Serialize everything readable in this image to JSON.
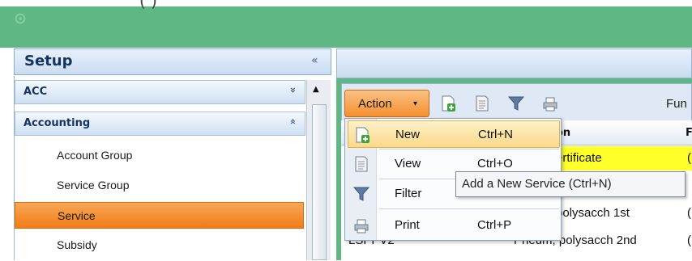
{
  "top_partial_text": "(          )",
  "sidebar": {
    "title": "Setup",
    "collapse_glyph": "«",
    "groups": [
      {
        "label": "ACC",
        "chevron": "»"
      },
      {
        "label": "Accounting",
        "chevron": "«"
      }
    ],
    "items": [
      {
        "label": "Account Group"
      },
      {
        "label": "Service Group"
      },
      {
        "label": "Service"
      },
      {
        "label": "Subsidy"
      }
    ],
    "active_item": "Service"
  },
  "toolbar": {
    "action_label": "Action",
    "caret": "▾",
    "partial_label": "Fun"
  },
  "grid": {
    "headers": {
      "description": "on",
      "next": "F"
    },
    "rows": [
      {
        "description": "ertificate",
        "next": "("
      },
      {
        "description": "",
        "next": ""
      },
      {
        "description": "polysacch 1st",
        "next": "("
      },
      {
        "code": "LSPPV2",
        "description": "Pneum, polysacch 2nd",
        "next": "("
      }
    ]
  },
  "menu": {
    "items": [
      {
        "label": "New",
        "shortcut": "Ctrl+N",
        "icon": "new-document-icon"
      },
      {
        "label": "View",
        "shortcut": "Ctrl+O",
        "icon": "view-document-icon"
      },
      {
        "label": "Filter",
        "shortcut": "",
        "icon": "filter-icon"
      },
      {
        "label": "Print",
        "shortcut": "Ctrl+P",
        "icon": "printer-icon"
      }
    ]
  },
  "tooltip": "Add a New Service (Ctrl+N)",
  "colors": {
    "background_green": "#5fb883",
    "active_orange": "#f07c15",
    "row_highlight": "#ffff2a",
    "header_blue": "#15335f"
  }
}
